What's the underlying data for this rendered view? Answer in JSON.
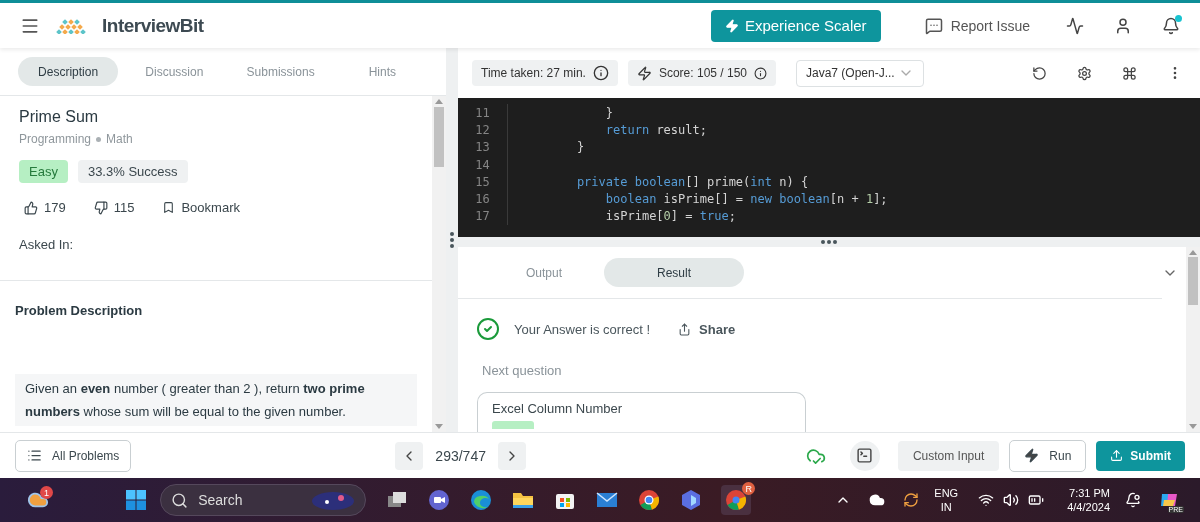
{
  "header": {
    "logo": "InterviewBit",
    "cta": "Experience Scaler",
    "report": "Report Issue",
    "has_notification": true
  },
  "problem": {
    "tabs": [
      {
        "label": "Description",
        "selected": true
      },
      {
        "label": "Discussion",
        "selected": false
      },
      {
        "label": "Submissions",
        "selected": false
      },
      {
        "label": "Hints",
        "selected": false
      }
    ],
    "title": "Prime Sum",
    "topics": [
      "Programming",
      "Math"
    ],
    "difficulty": "Easy",
    "success": "33.3% Success",
    "likes": "179",
    "dislikes": "115",
    "bookmark": "Bookmark",
    "asked_in": "Asked In:",
    "section": "Problem Description",
    "description": "Given an **even** number ( greater than 2 ), return **two prime numbers** whose sum will be equal to the given number."
  },
  "editor": {
    "time": "Time taken: 27 min.",
    "score": "Score:  105  /  150",
    "language": "Java7 (Open-J...",
    "lines": [
      {
        "number": "11",
        "tokens": [
          {
            "kind": "plain",
            "text": "        }"
          }
        ]
      },
      {
        "number": "12",
        "tokens": [
          {
            "kind": "keyword",
            "text": "        return"
          },
          {
            "kind": "plain",
            "text": " result;"
          }
        ]
      },
      {
        "number": "13",
        "tokens": [
          {
            "kind": "plain",
            "text": "    }"
          }
        ]
      },
      {
        "number": "14"
      },
      {
        "number": "15",
        "tokens": [
          {
            "kind": "keyword",
            "text": "    private boolean"
          },
          {
            "kind": "plain",
            "text": "[] prime("
          },
          {
            "kind": "keyword",
            "text": "int"
          },
          {
            "kind": "plain",
            "text": " n) {"
          }
        ]
      },
      {
        "number": "16",
        "tokens": [
          {
            "kind": "keyword",
            "text": "        boolean"
          },
          {
            "kind": "plain",
            "text": " isPrime[] = "
          },
          {
            "kind": "keyword",
            "text": "new boolean"
          },
          {
            "kind": "plain",
            "text": "[n + "
          },
          {
            "kind": "number",
            "text": "1"
          },
          {
            "kind": "plain",
            "text": "];"
          }
        ]
      },
      {
        "number": "17",
        "tokens": [
          {
            "kind": "plain",
            "text": "        isPrime["
          },
          {
            "kind": "number",
            "text": "0"
          },
          {
            "kind": "plain",
            "text": "] = "
          },
          {
            "kind": "keyword",
            "text": "true"
          },
          {
            "kind": "plain",
            "text": ";"
          }
        ]
      }
    ]
  },
  "result": {
    "tabs": [
      {
        "label": "Output",
        "selected": false
      },
      {
        "label": "Result",
        "selected": true
      }
    ],
    "message": "Your Answer is correct !",
    "share": "Share",
    "next_label": "Next question",
    "next_title": "Excel Column Number"
  },
  "footer": {
    "all_problems": "All Problems",
    "pager": "293/747",
    "custom_input": "Custom Input",
    "run": "Run",
    "submit": "Submit"
  },
  "taskbar": {
    "weather_badge": "1",
    "search": "Search",
    "app_badge": "R",
    "lang": "ENG",
    "region": "IN",
    "time": "7:31 PM",
    "date": "4/4/2024",
    "copilot_badge": "PRE"
  }
}
